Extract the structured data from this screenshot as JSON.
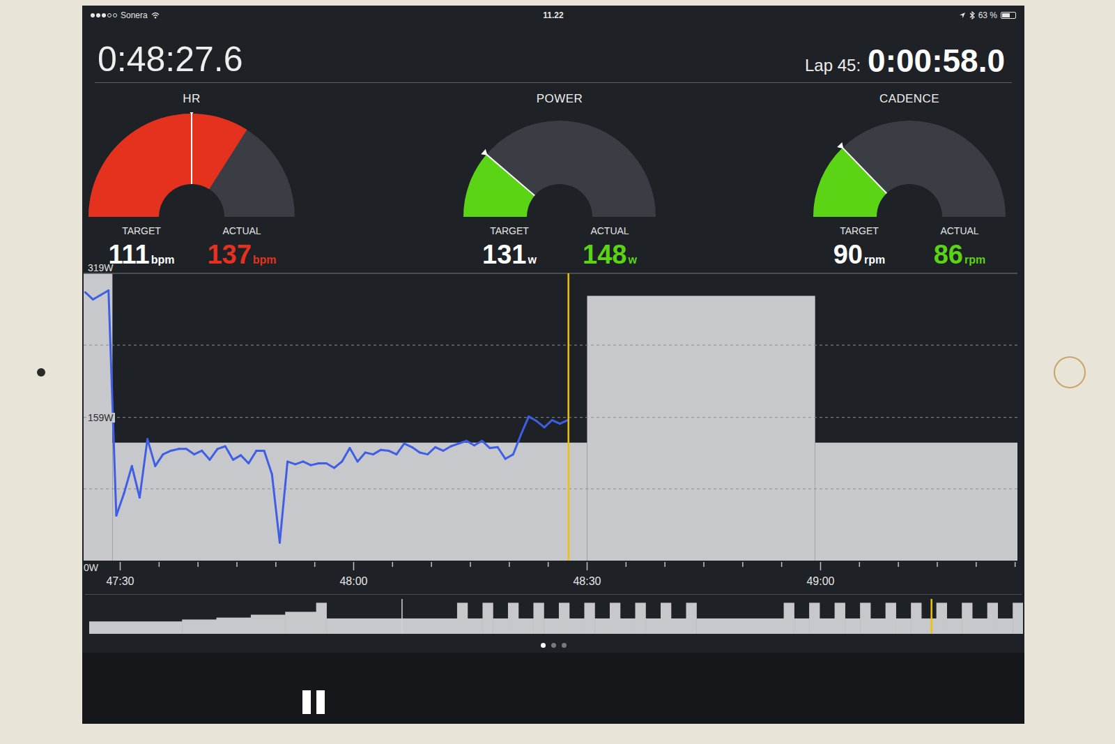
{
  "status_bar": {
    "signal_level": 0.6,
    "carrier": "Sonera",
    "time": "11.22",
    "battery": "63 %",
    "battery_level": 0.63
  },
  "workout": {
    "elapsed": "0:48:27.6",
    "lap_label": "Lap 45:",
    "lap_time": "0:00:58.0"
  },
  "gauges": [
    {
      "title": "HR",
      "target_label": "TARGET",
      "target": "111",
      "target_unit": "bpm",
      "actual_label": "ACTUAL",
      "actual": "137",
      "actual_unit": "bpm",
      "level": 0.68,
      "target_level": 0.5,
      "color": "#e5321e"
    },
    {
      "title": "POWER",
      "target_label": "TARGET",
      "target": "131",
      "target_unit": "w",
      "actual_label": "ACTUAL",
      "actual": "148",
      "actual_unit": "w",
      "level": 0.225,
      "target_level": 0.225,
      "color": "#5ad415"
    },
    {
      "title": "CADENCE",
      "target_label": "TARGET",
      "target": "90",
      "target_unit": "rpm",
      "actual_label": "ACTUAL",
      "actual": "86",
      "actual_unit": "rpm",
      "level": 0.255,
      "target_level": 0.255,
      "color": "#5ad415"
    }
  ],
  "chart": {
    "start": 2845.3,
    "end": 2965.3,
    "max": 319,
    "y_ticks": [
      {
        "label": "319W",
        "value": 319
      },
      {
        "label": "159W",
        "value": 159
      },
      {
        "label": "0W",
        "value": 0
      }
    ],
    "x_ticks": [
      {
        "label": "47:30",
        "t": 2850
      },
      {
        "label": "48:00",
        "t": 2880
      },
      {
        "label": "48:30",
        "t": 2910
      },
      {
        "label": "49:00",
        "t": 2940
      }
    ],
    "target": [
      {
        "watts": 319,
        "from": 2845.3,
        "to": 2849
      },
      {
        "watts": 131,
        "from": 2849,
        "to": 2910
      },
      {
        "watts": 294,
        "from": 2910,
        "to": 2939.3
      },
      {
        "watts": 131,
        "from": 2939.3,
        "to": 2965.3
      }
    ],
    "actual": {
      "start": 2845.5,
      "interval": 1,
      "values": [
        298,
        290,
        295,
        300,
        50,
        75,
        105,
        70,
        135,
        105,
        118,
        122,
        124,
        124,
        118,
        122,
        112,
        124,
        127,
        112,
        117,
        108,
        122,
        122,
        96,
        20,
        110,
        107,
        110,
        106,
        108,
        108,
        103,
        110,
        125,
        110,
        120,
        118,
        123,
        122,
        118,
        130,
        126,
        120,
        118,
        126,
        122,
        127,
        130,
        133,
        128,
        133,
        125,
        126,
        113,
        118,
        140,
        160,
        155,
        148,
        156,
        152,
        156
      ]
    },
    "cursor": 2907.6
  },
  "overview": {
    "segments": [
      [
        100,
        135
      ],
      [
        120,
        50
      ],
      [
        140,
        50
      ],
      [
        170,
        50
      ],
      [
        200,
        45
      ],
      [
        294,
        15
      ],
      [
        131,
        190
      ],
      [
        294,
        15
      ],
      [
        131,
        22
      ],
      [
        294,
        15
      ],
      [
        131,
        22
      ],
      [
        294,
        15
      ],
      [
        131,
        22
      ],
      [
        294,
        15
      ],
      [
        131,
        22
      ],
      [
        294,
        15
      ],
      [
        131,
        22
      ],
      [
        294,
        15
      ],
      [
        131,
        22
      ],
      [
        294,
        15
      ],
      [
        131,
        22
      ],
      [
        294,
        15
      ],
      [
        131,
        22
      ],
      [
        294,
        15
      ],
      [
        131,
        22
      ],
      [
        294,
        15
      ],
      [
        131,
        127
      ],
      [
        294,
        15
      ],
      [
        131,
        22
      ],
      [
        294,
        15
      ],
      [
        131,
        22
      ],
      [
        294,
        15
      ],
      [
        131,
        22
      ],
      [
        294,
        15
      ],
      [
        131,
        22
      ],
      [
        294,
        15
      ],
      [
        131,
        22
      ],
      [
        294,
        15
      ],
      [
        131,
        22
      ],
      [
        294,
        15
      ],
      [
        131,
        22
      ],
      [
        294,
        15
      ],
      [
        131,
        22
      ],
      [
        294,
        15
      ],
      [
        131,
        22
      ],
      [
        294,
        15
      ]
    ],
    "window_start": 0.335,
    "position": 0.902
  },
  "pages": [
    {
      "selected": true
    },
    {
      "selected": false
    },
    {
      "selected": false
    }
  ],
  "controls": {
    "paused": false
  }
}
